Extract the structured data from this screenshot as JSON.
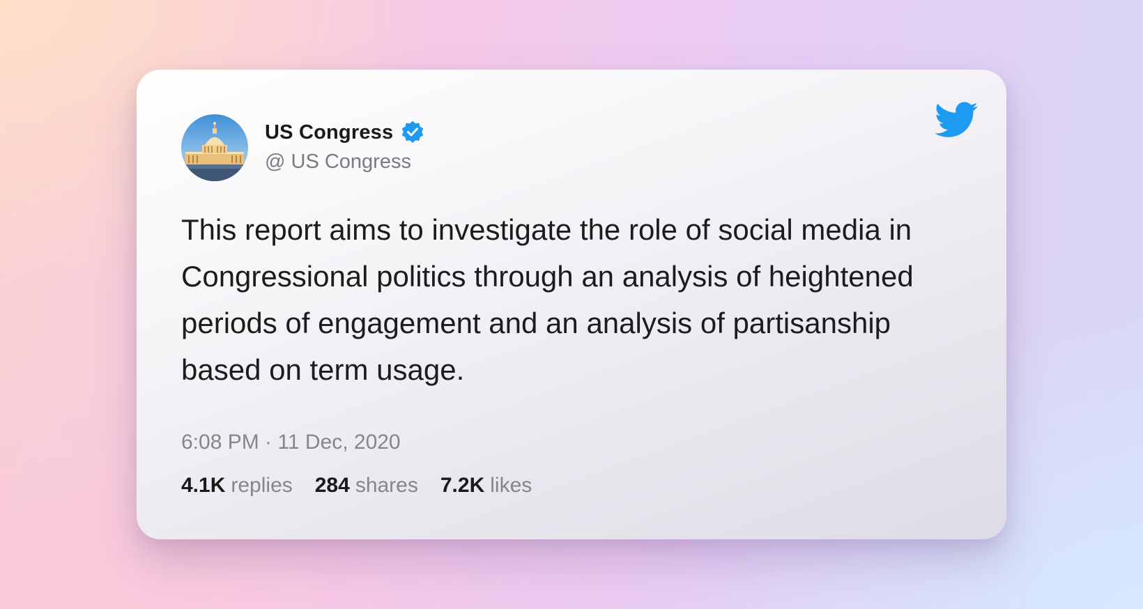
{
  "account": {
    "display_name": "US Congress",
    "handle": "@ US Congress",
    "verified": true,
    "avatar_icon": "capitol-building-icon"
  },
  "platform_icon": "twitter-bird-icon",
  "colors": {
    "verified_blue": "#1d9bf0",
    "twitter_blue": "#1d9bf0",
    "text_primary": "#1a1a1a",
    "text_secondary": "#85858b"
  },
  "tweet": {
    "text": "This report aims to investigate the role of social media in Congressional politics through an analysis of heightened periods of engagement and an analysis of partisanship based on term usage.",
    "timestamp": "6:08 PM · 11 Dec, 2020"
  },
  "stats": {
    "replies": {
      "count": "4.1K",
      "label": "replies"
    },
    "shares": {
      "count": "284",
      "label": "shares"
    },
    "likes": {
      "count": "7.2K",
      "label": "likes"
    }
  }
}
